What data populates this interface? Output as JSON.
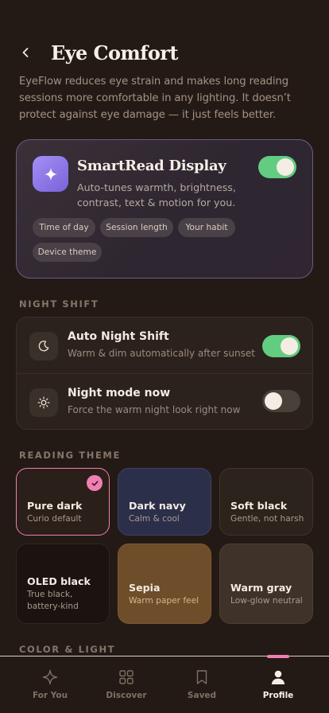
{
  "header": {
    "title": "Eye Comfort",
    "back_icon": "chevron-left-icon"
  },
  "intro": "EyeFlow reduces eye strain and makes long reading sessions more comfortable in any lighting. It doesn’t protect against eye damage — it just feels better.",
  "smart_read": {
    "title": "SmartRead Display",
    "description": "Auto-tunes warmth, brightness, contrast, text & motion for you.",
    "icon": "sparkle-icon",
    "enabled": true,
    "chips": [
      "Time of day",
      "Session length",
      "Your habit",
      "Device theme"
    ]
  },
  "night_shift": {
    "label": "NIGHT SHIFT",
    "items": [
      {
        "title": "Auto Night Shift",
        "subtitle": "Warm & dim automatically after sunset",
        "icon": "moon-icon",
        "enabled": true
      },
      {
        "title": "Night mode now",
        "subtitle": "Force the warm night look right now",
        "icon": "sun-icon",
        "enabled": false
      }
    ]
  },
  "reading_theme": {
    "label": "READING THEME",
    "themes": [
      {
        "name": "Pure dark",
        "subtitle": "Curio default",
        "selected": true,
        "bg": "#2a1f19"
      },
      {
        "name": "Dark navy",
        "subtitle": "Calm & cool",
        "selected": false,
        "bg": "#2b2f4a"
      },
      {
        "name": "Soft black",
        "subtitle": "Gentle, not harsh",
        "selected": false,
        "bg": "#2c231c"
      },
      {
        "name": "OLED black",
        "subtitle": "True black, battery-kind",
        "selected": false,
        "bg": "#1a130f"
      },
      {
        "name": "Sepia",
        "subtitle": "Warm paper feel",
        "selected": false,
        "bg": "#6e4d2a"
      },
      {
        "name": "Warm gray",
        "subtitle": "Low-glow neutral",
        "selected": false,
        "bg": "#3f3329"
      }
    ]
  },
  "color_light": {
    "label": "COLOR & LIGHT"
  },
  "nav": {
    "items": [
      {
        "label": "For You",
        "icon": "sparkle-icon",
        "active": false
      },
      {
        "label": "Discover",
        "icon": "grid-icon",
        "active": false
      },
      {
        "label": "Saved",
        "icon": "bookmark-icon",
        "active": false
      },
      {
        "label": "Profile",
        "icon": "person-icon",
        "active": true
      }
    ]
  },
  "colors": {
    "background": "#241a15",
    "accent_pink": "#f07fb2",
    "toggle_on": "#62cd80",
    "smart_icon": "#8f78ea"
  }
}
